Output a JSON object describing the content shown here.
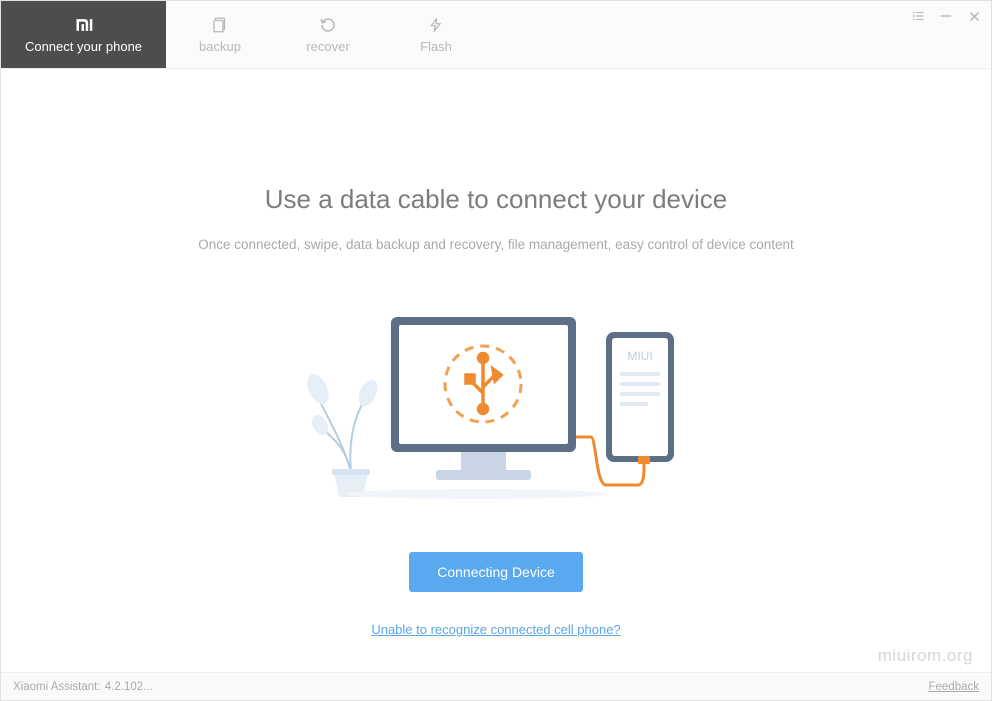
{
  "tabs": {
    "connect": "Connect your phone",
    "backup": "backup",
    "recover": "recover",
    "flash": "Flash"
  },
  "main": {
    "heading": "Use a data cable to connect your device",
    "subheading": "Once connected, swipe, data backup and recovery, file management, easy control of device content",
    "button": "Connecting Device",
    "help_link": "Unable to recognize connected cell phone?",
    "phone_badge": "MIUI"
  },
  "footer": {
    "version_label": "Xiaomi Assistant",
    "version_value": "4.2.102...",
    "version_separator": ": ",
    "feedback": "Feedback"
  },
  "watermark": "miuirom.org"
}
